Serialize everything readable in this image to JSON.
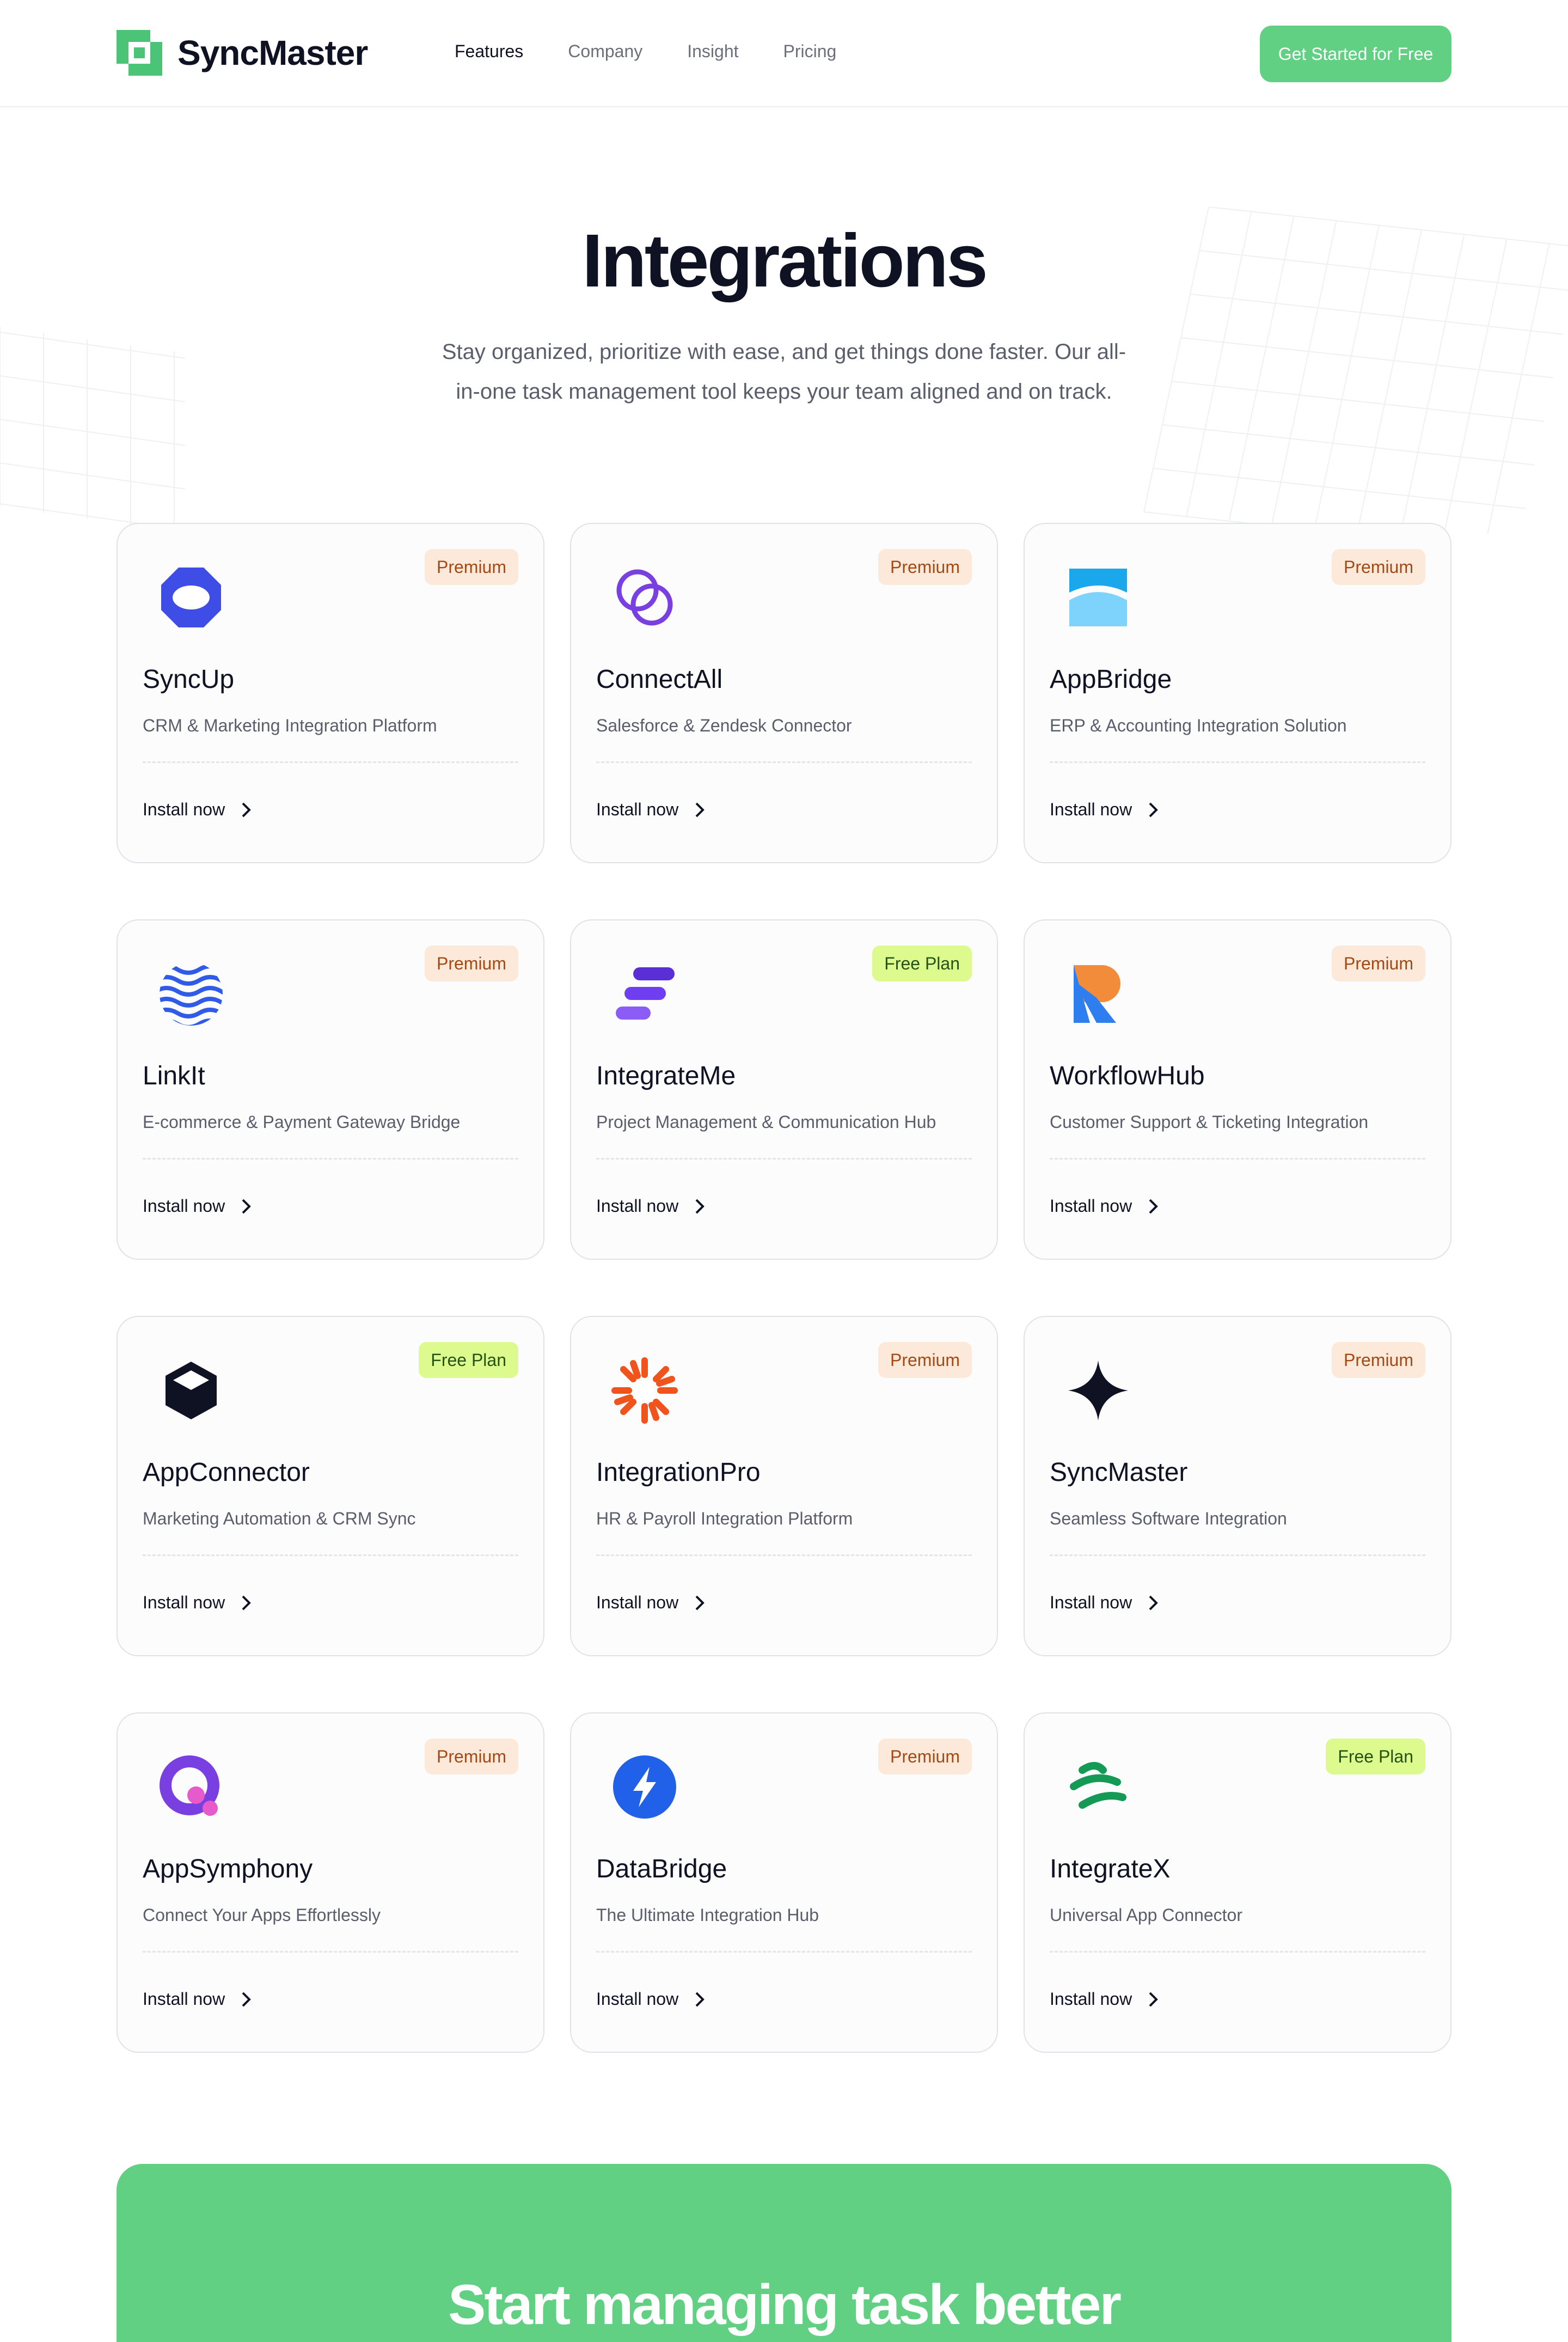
{
  "nav": {
    "brand": "SyncMaster",
    "links": [
      {
        "label": "Features",
        "active": true
      },
      {
        "label": "Company",
        "active": false
      },
      {
        "label": "Insight",
        "active": false
      },
      {
        "label": "Pricing",
        "active": false
      }
    ],
    "cta": "Get Started for Free"
  },
  "hero": {
    "title": "Integrations",
    "subtitle": "Stay organized, prioritize with ease, and get things done faster. Our all-in-one task management tool keeps your team aligned and on track."
  },
  "integrations": [
    {
      "name": "SyncUp",
      "description": "CRM & Marketing Integration Platform",
      "badge": "Premium",
      "icon": "hexagon-ring-icon",
      "action": "Install now"
    },
    {
      "name": "ConnectAll",
      "description": "Salesforce & Zendesk Connector",
      "badge": "Premium",
      "icon": "linked-circles-icon",
      "action": "Install now"
    },
    {
      "name": "AppBridge",
      "description": "ERP & Accounting Integration Solution",
      "badge": "Premium",
      "icon": "bridge-arc-icon",
      "action": "Install now"
    },
    {
      "name": "LinkIt",
      "description": "E-commerce & Payment Gateway Bridge",
      "badge": "Premium",
      "icon": "wave-globe-icon",
      "action": "Install now"
    },
    {
      "name": "IntegrateMe",
      "description": "Project Management & Communication Hub",
      "badge": "Free Plan",
      "icon": "stacked-bars-icon",
      "action": "Install now"
    },
    {
      "name": "WorkflowHub",
      "description": "Customer Support & Ticketing Integration",
      "badge": "Premium",
      "icon": "r-shape-icon",
      "action": "Install now"
    },
    {
      "name": "AppConnector",
      "description": "Marketing Automation & CRM Sync",
      "badge": "Free Plan",
      "icon": "cube-icon",
      "action": "Install now"
    },
    {
      "name": "IntegrationPro",
      "description": "HR & Payroll Integration Platform",
      "badge": "Premium",
      "icon": "sunburst-icon",
      "action": "Install now"
    },
    {
      "name": "SyncMaster",
      "description": "Seamless Software Integration",
      "badge": "Premium",
      "icon": "four-point-star-icon",
      "action": "Install now"
    },
    {
      "name": "AppSymphony",
      "description": "Connect Your Apps Effortlessly",
      "badge": "Premium",
      "icon": "q-ring-icon",
      "action": "Install now"
    },
    {
      "name": "DataBridge",
      "description": "The Ultimate Integration Hub",
      "badge": "Premium",
      "icon": "lightning-bolt-icon",
      "action": "Install now"
    },
    {
      "name": "IntegrateX",
      "description": "Universal App Connector",
      "badge": "Free Plan",
      "icon": "slanted-stripes-icon",
      "action": "Install now"
    }
  ],
  "cta_banner": {
    "title": "Start managing task better"
  },
  "colors": {
    "brand_green": "#62d083",
    "premium_badge_bg": "#fde9d9",
    "premium_badge_text": "#a24a16",
    "free_badge_bg": "#dcfa8e",
    "free_badge_text": "#255217"
  }
}
